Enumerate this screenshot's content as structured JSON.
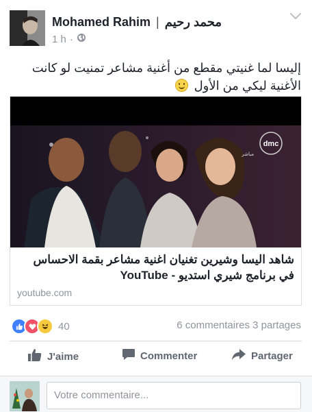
{
  "post": {
    "author_name": "Mohamed Rahim",
    "author_separator": "|",
    "author_alt_name": "محمد رحيم",
    "time": "1 h",
    "message": "إليسا لما غنيتي مقطع من أغنية مشاعر تمنيت لو كانت الأغنية ليكي من الأول"
  },
  "link_preview": {
    "title": "شاهد اليسا وشيرين تغنيان اغنية مشاعر بقمة الاحساس في برنامج شيري استديو - YouTube",
    "domain": "youtube.com",
    "channel_logo": "dmc",
    "channel_sub": "مباشر"
  },
  "engagement": {
    "reaction_icons": [
      "like-icon",
      "love-icon",
      "haha-icon"
    ],
    "reaction_count": "40",
    "comments_shares": "6 commentaires 3 partages"
  },
  "actions": {
    "like": "J'aime",
    "comment": "Commenter",
    "share": "Partager"
  },
  "comment_box": {
    "placeholder": "Votre commentaire..."
  },
  "colors": {
    "like_blue": "#4080ff",
    "love_red": "#f25268",
    "haha_yellow": "#f7c93f",
    "text_primary": "#1d2129",
    "text_secondary": "#90949c",
    "action_gray": "#606770"
  }
}
